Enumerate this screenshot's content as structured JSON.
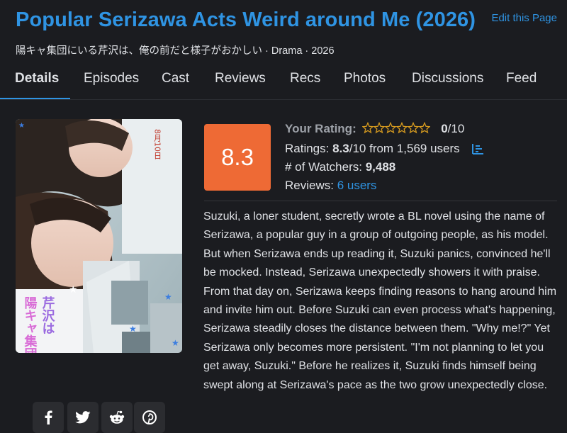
{
  "header": {
    "title": "Popular Serizawa Acts Weird around Me (2026)",
    "edit_label": "Edit this Page",
    "native_title": "陽キャ集団にいる芹沢は、俺の前だと様子がおかしい",
    "meta": " · Drama · 2026"
  },
  "tabs": [
    "Details",
    "Episodes",
    "Cast",
    "Reviews",
    "Recs",
    "Photos",
    "Discussions",
    "Feed"
  ],
  "poster": {
    "date_text": "8月10日",
    "title_art": "陽キャ集団にいる芹沢は"
  },
  "score": "8.3",
  "rating": {
    "your_rating_label": "Your Rating:",
    "your_rating_value": "0",
    "your_rating_max": "/10",
    "ratings_label": "Ratings: ",
    "ratings_value": "8.3",
    "ratings_rest": "/10 from 1,569 users",
    "watchers_label": "# of Watchers: ",
    "watchers_value": "9,488",
    "reviews_label": "Reviews: ",
    "reviews_link": "6 users",
    "stars_filled": 0,
    "stars_total": 6
  },
  "synopsis": "Suzuki, a loner student, secretly wrote a BL novel using the name of Serizawa, a popular guy in a group of outgoing people, as his model. But when Serizawa ends up reading it, Suzuki panics, convinced he'll be mocked. Instead, Serizawa unexpectedly showers it with praise. From that day on, Serizawa keeps finding reasons to hang around him and invite him out. Before Suzuki can even process what's happening, Serizawa steadily closes the distance between them. \"Why me!?\" Yet Serizawa only becomes more persistent. \"I'm not planning to let you get away, Suzuki.\" Before he realizes it, Suzuki finds himself being swept along at Serizawa's pace as the two grow unexpectedly close.",
  "share": [
    "facebook-icon",
    "twitter-icon",
    "reddit-icon",
    "pinterest-icon"
  ],
  "colors": {
    "accent": "#2f94e3",
    "score_bg": "#ee6a35",
    "background": "#1b1c20"
  }
}
